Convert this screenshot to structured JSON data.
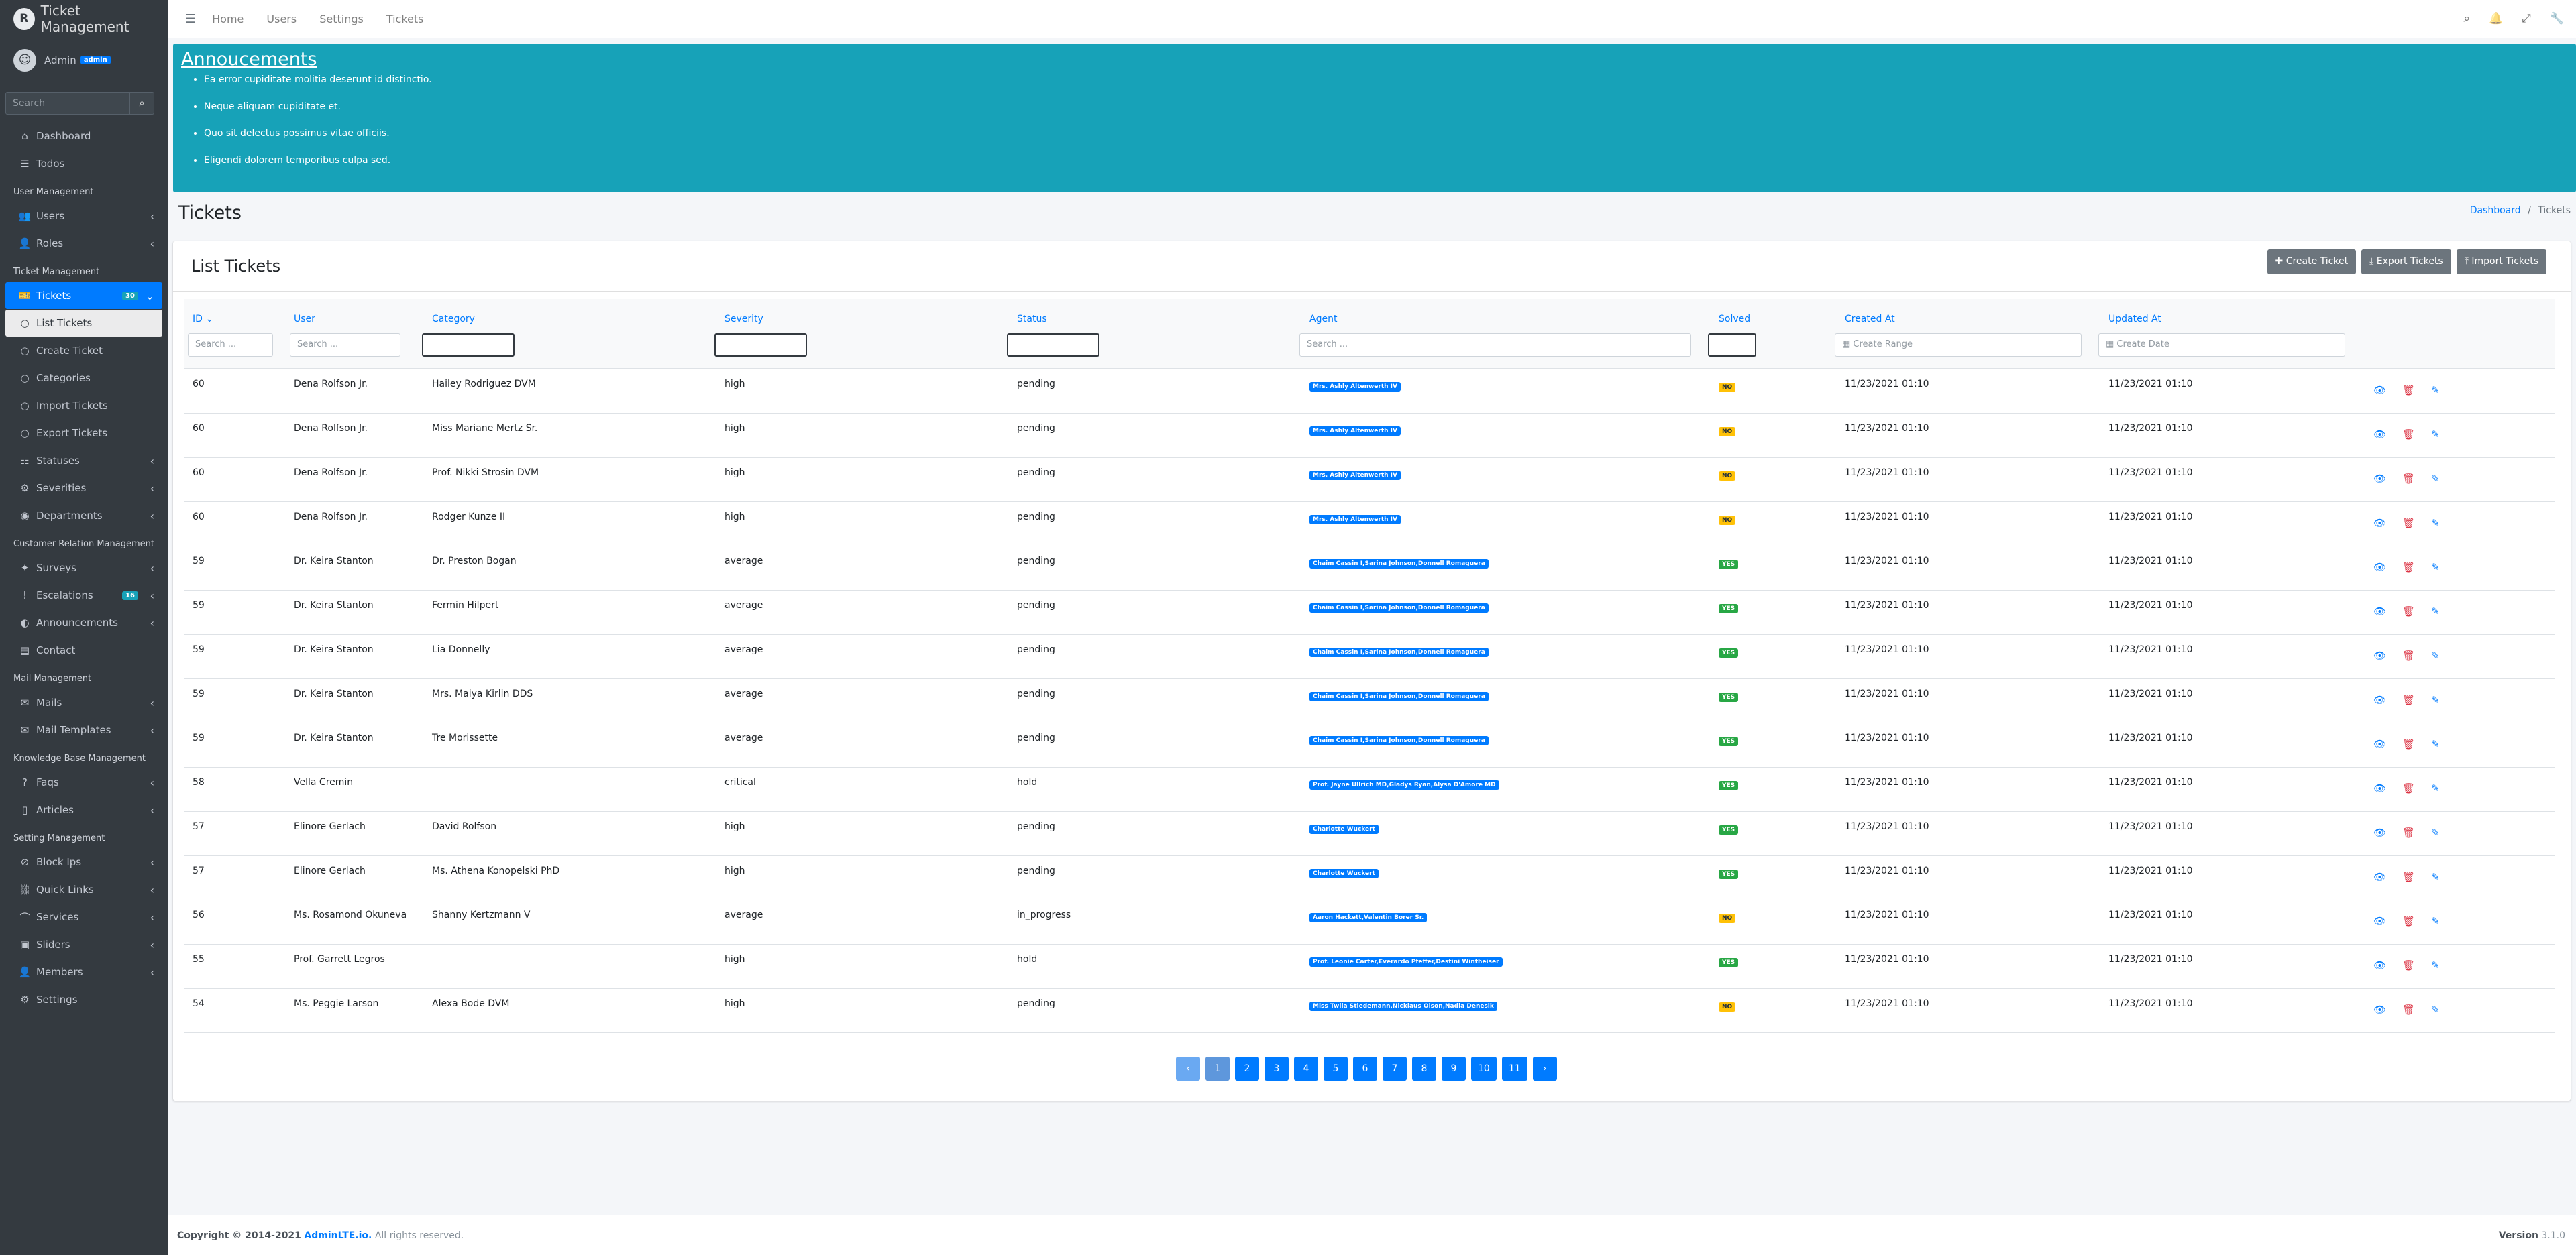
{
  "app": {
    "title": "Ticket Management",
    "logo_letter": "R"
  },
  "user": {
    "name": "Admin",
    "badge": "admin"
  },
  "sidebar": {
    "search_placeholder": "Search",
    "top_items": [
      {
        "label": "Dashboard",
        "icon": "home-icon"
      },
      {
        "label": "Todos",
        "icon": "list-icon"
      }
    ],
    "headers": {
      "user_mgmt": "User Management",
      "ticket_mgmt": "Ticket Management",
      "crm": "Customer Relation Management",
      "mail": "Mail Management",
      "kb": "Knowledge Base Management",
      "setting": "Setting Management"
    },
    "user_items": [
      {
        "label": "Users"
      },
      {
        "label": "Roles"
      }
    ],
    "tickets": {
      "label": "Tickets",
      "count": "30"
    },
    "ticket_sub": [
      "List Tickets",
      "Create Ticket",
      "Categories",
      "Import Tickets",
      "Export Tickets"
    ],
    "ticket_items": [
      "Statuses",
      "Severities",
      "Departments"
    ],
    "crm_items": [
      {
        "label": "Surveys"
      },
      {
        "label": "Escalations",
        "count": "16"
      },
      {
        "label": "Announcements"
      },
      {
        "label": "Contact"
      }
    ],
    "mail_items": [
      "Mails",
      "Mail Templates"
    ],
    "kb_items": [
      "Faqs",
      "Articles"
    ],
    "setting_items": [
      "Block Ips",
      "Quick Links",
      "Services",
      "Sliders",
      "Members",
      "Settings"
    ]
  },
  "topnav": {
    "links": [
      "Home",
      "Users",
      "Settings",
      "Tickets"
    ]
  },
  "announcements": {
    "title": "Annoucements",
    "items": [
      "Ea error cupiditate molitia deserunt id distinctio.",
      "Neque aliquam cupiditate et.",
      "Quo sit delectus possimus vitae officiis.",
      "Eligendi dolorem temporibus culpa sed."
    ]
  },
  "page": {
    "title": "Tickets",
    "breadcrumb_home": "Dashboard",
    "breadcrumb_sep": "/",
    "breadcrumb_current": "Tickets"
  },
  "card": {
    "title": "List Tickets",
    "buttons": [
      "Create Ticket",
      "Export Tickets",
      "Import Tickets"
    ]
  },
  "table": {
    "headers": [
      "ID",
      "User",
      "Category",
      "Severity",
      "Status",
      "Agent",
      "Solved",
      "Created At",
      "Updated At"
    ],
    "filters": {
      "id": "Search ...",
      "user": "Search ...",
      "agent": "Search ...",
      "created": "Create Range",
      "updated": "Create Date"
    },
    "rows": [
      {
        "id": "60",
        "user": "Dena Rolfson Jr.",
        "category": "Hailey Rodriguez DVM",
        "severity": "high",
        "status": "pending",
        "agent": "Mrs. Ashly Altenwerth IV",
        "solved": "NO",
        "created": "11/23/2021 01:10",
        "updated": "11/23/2021 01:10"
      },
      {
        "id": "60",
        "user": "Dena Rolfson Jr.",
        "category": "Miss Mariane Mertz Sr.",
        "severity": "high",
        "status": "pending",
        "agent": "Mrs. Ashly Altenwerth IV",
        "solved": "NO",
        "created": "11/23/2021 01:10",
        "updated": "11/23/2021 01:10"
      },
      {
        "id": "60",
        "user": "Dena Rolfson Jr.",
        "category": "Prof. Nikki Strosin DVM",
        "severity": "high",
        "status": "pending",
        "agent": "Mrs. Ashly Altenwerth IV",
        "solved": "NO",
        "created": "11/23/2021 01:10",
        "updated": "11/23/2021 01:10"
      },
      {
        "id": "60",
        "user": "Dena Rolfson Jr.",
        "category": "Rodger Kunze II",
        "severity": "high",
        "status": "pending",
        "agent": "Mrs. Ashly Altenwerth IV",
        "solved": "NO",
        "created": "11/23/2021 01:10",
        "updated": "11/23/2021 01:10"
      },
      {
        "id": "59",
        "user": "Dr. Keira Stanton",
        "category": "Dr. Preston Bogan",
        "severity": "average",
        "status": "pending",
        "agent": "Chaim Cassin I,Sarina Johnson,Donnell Romaguera",
        "solved": "YES",
        "created": "11/23/2021 01:10",
        "updated": "11/23/2021 01:10"
      },
      {
        "id": "59",
        "user": "Dr. Keira Stanton",
        "category": "Fermin Hilpert",
        "severity": "average",
        "status": "pending",
        "agent": "Chaim Cassin I,Sarina Johnson,Donnell Romaguera",
        "solved": "YES",
        "created": "11/23/2021 01:10",
        "updated": "11/23/2021 01:10"
      },
      {
        "id": "59",
        "user": "Dr. Keira Stanton",
        "category": "Lia Donnelly",
        "severity": "average",
        "status": "pending",
        "agent": "Chaim Cassin I,Sarina Johnson,Donnell Romaguera",
        "solved": "YES",
        "created": "11/23/2021 01:10",
        "updated": "11/23/2021 01:10"
      },
      {
        "id": "59",
        "user": "Dr. Keira Stanton",
        "category": "Mrs. Maiya Kirlin DDS",
        "severity": "average",
        "status": "pending",
        "agent": "Chaim Cassin I,Sarina Johnson,Donnell Romaguera",
        "solved": "YES",
        "created": "11/23/2021 01:10",
        "updated": "11/23/2021 01:10"
      },
      {
        "id": "59",
        "user": "Dr. Keira Stanton",
        "category": "Tre Morissette",
        "severity": "average",
        "status": "pending",
        "agent": "Chaim Cassin I,Sarina Johnson,Donnell Romaguera",
        "solved": "YES",
        "created": "11/23/2021 01:10",
        "updated": "11/23/2021 01:10"
      },
      {
        "id": "58",
        "user": "Vella Cremin",
        "category": "",
        "severity": "critical",
        "status": "hold",
        "agent": "Prof. Jayne Ullrich MD,Gladys Ryan,Alysa D'Amore MD",
        "solved": "YES",
        "created": "11/23/2021 01:10",
        "updated": "11/23/2021 01:10"
      },
      {
        "id": "57",
        "user": "Elinore Gerlach",
        "category": "David Rolfson",
        "severity": "high",
        "status": "pending",
        "agent": "Charlotte Wuckert",
        "solved": "YES",
        "created": "11/23/2021 01:10",
        "updated": "11/23/2021 01:10"
      },
      {
        "id": "57",
        "user": "Elinore Gerlach",
        "category": "Ms. Athena Konopelski PhD",
        "severity": "high",
        "status": "pending",
        "agent": "Charlotte Wuckert",
        "solved": "YES",
        "created": "11/23/2021 01:10",
        "updated": "11/23/2021 01:10"
      },
      {
        "id": "56",
        "user": "Ms. Rosamond Okuneva",
        "category": "Shanny Kertzmann V",
        "severity": "average",
        "status": "in_progress",
        "agent": "Aaron Hackett,Valentin Borer Sr.",
        "solved": "NO",
        "created": "11/23/2021 01:10",
        "updated": "11/23/2021 01:10"
      },
      {
        "id": "55",
        "user": "Prof. Garrett Legros",
        "category": "",
        "severity": "high",
        "status": "hold",
        "agent": "Prof. Leonie Carter,Everardo Pfeffer,Destini Wintheiser",
        "solved": "YES",
        "created": "11/23/2021 01:10",
        "updated": "11/23/2021 01:10"
      },
      {
        "id": "54",
        "user": "Ms. Peggie Larson",
        "category": "Alexa Bode DVM",
        "severity": "high",
        "status": "pending",
        "agent": "Miss Twila Stiedemann,Nicklaus Olson,Nadia Denesik",
        "solved": "NO",
        "created": "11/23/2021 01:10",
        "updated": "11/23/2021 01:10"
      }
    ]
  },
  "pagination": {
    "prev": "‹",
    "next": "›",
    "pages": [
      "1",
      "2",
      "3",
      "4",
      "5",
      "6",
      "7",
      "8",
      "9",
      "10",
      "11"
    ]
  },
  "footer": {
    "copyright": "Copyright © 2014-2021",
    "brand": "AdminLTE.io.",
    "rights": "All rights reserved.",
    "version_label": "Version",
    "version": "3.1.0"
  },
  "colors": {
    "primary": "#007bff",
    "info": "#17a2b8",
    "sidebar": "#343a40",
    "warning": "#ffc107",
    "success": "#28a745",
    "danger": "#dc3545"
  }
}
